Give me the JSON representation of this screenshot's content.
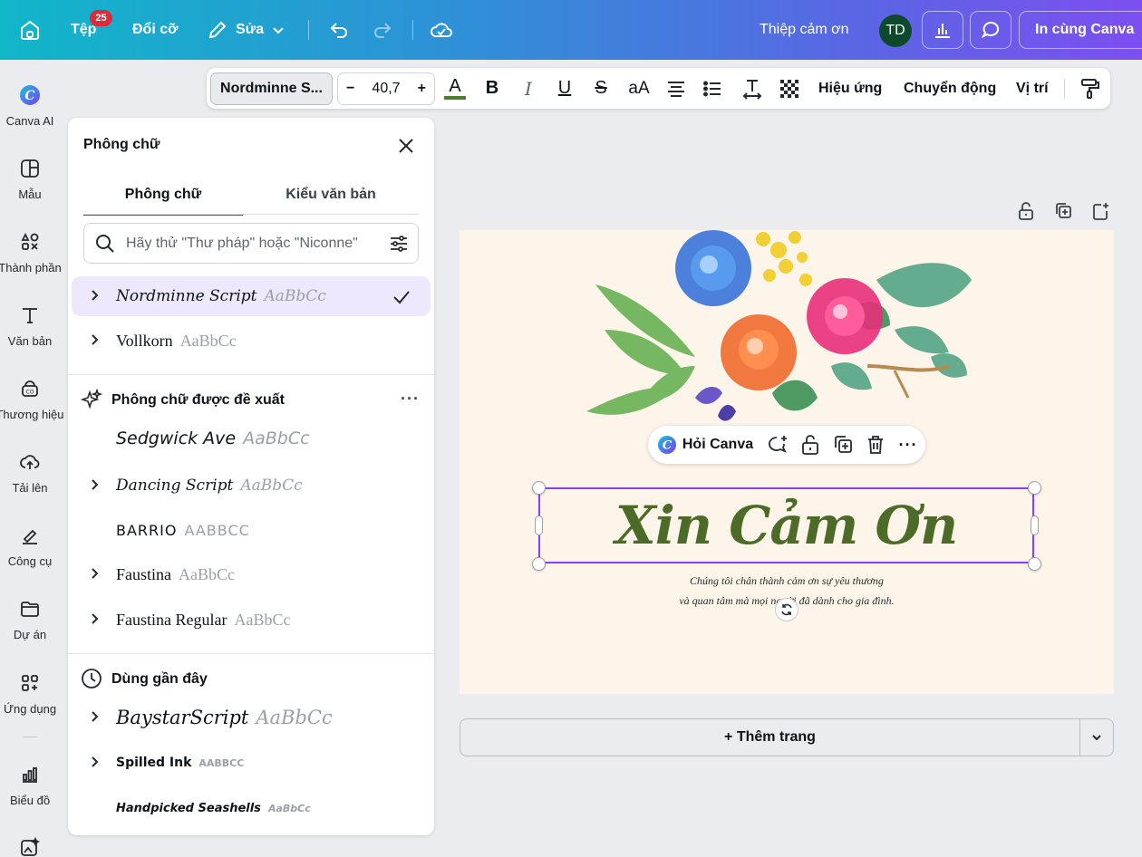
{
  "topbar": {
    "file_label": "Tệp",
    "file_badge": "25",
    "resize_label": "Đổi cỡ",
    "edit_label": "Sửa",
    "doc_title": "Thiệp cảm ơn",
    "avatar_initials": "TD",
    "print_label": "In cùng Canva"
  },
  "rail": {
    "items": [
      {
        "label": "Canva AI",
        "icon": "canva-ai-icon"
      },
      {
        "label": "Mẫu",
        "icon": "templates-icon"
      },
      {
        "label": "Thành phần",
        "icon": "elements-icon"
      },
      {
        "label": "Văn bản",
        "icon": "text-icon"
      },
      {
        "label": "Thương hiệu",
        "icon": "brand-icon"
      },
      {
        "label": "Tải lên",
        "icon": "upload-icon"
      },
      {
        "label": "Công cụ",
        "icon": "tools-icon"
      },
      {
        "label": "Dự án",
        "icon": "projects-icon"
      },
      {
        "label": "Ứng dụng",
        "icon": "apps-icon"
      },
      {
        "label": "Biểu đồ",
        "icon": "charts-icon"
      }
    ]
  },
  "toolbar": {
    "font_name": "Nordminne S...",
    "font_size": "40,7",
    "minus": "−",
    "plus": "+",
    "color_letter": "A",
    "bold": "B",
    "italic": "I",
    "underline": "U",
    "strike": "S",
    "case": "aA",
    "effects_label": "Hiệu ứng",
    "animate_label": "Chuyển động",
    "position_label": "Vị trí",
    "text_color": "#4d7a2c"
  },
  "panel": {
    "title": "Phông chữ",
    "tabs": [
      "Phông chữ",
      "Kiểu văn bản"
    ],
    "search_placeholder": "Hãy thử \"Thư pháp\" hoặc \"Niconne\"",
    "current_fonts": [
      {
        "name": "Nordminne Script",
        "sample": "AaBbCc",
        "selected": true
      },
      {
        "name": "Vollkorn",
        "sample": "AaBbCc",
        "selected": false
      }
    ],
    "suggested_title": "Phông chữ được đề xuất",
    "suggested_fonts": [
      {
        "name": "Sedgwick Ave",
        "sample": "AaBbCc"
      },
      {
        "name": "Dancing Script",
        "sample": "AaBbCc"
      },
      {
        "name": "BARRIO",
        "sample": "AABBCC"
      },
      {
        "name": "Faustina",
        "sample": "AaBbCc"
      },
      {
        "name": "Faustina Regular",
        "sample": "AaBbCc"
      }
    ],
    "recent_title": "Dùng gần đây",
    "recent_fonts": [
      {
        "name": "BaystarScript",
        "sample": "AaBbCc"
      },
      {
        "name": "Spilled Ink",
        "sample": "AABBCC"
      },
      {
        "name": "Handpicked Seashells",
        "sample": "AaBbCc"
      }
    ]
  },
  "canvas": {
    "ask_canva": "Hỏi Canva",
    "headline": "Xin Cảm Ơn",
    "body_line_1": "Chúng tôi chân thành cảm ơn sự yêu thương",
    "body_line_2": "và quan tâm mà mọi người đã dành cho gia đình.",
    "add_page": "+ Thêm trang",
    "accent": "#8b3dff"
  }
}
